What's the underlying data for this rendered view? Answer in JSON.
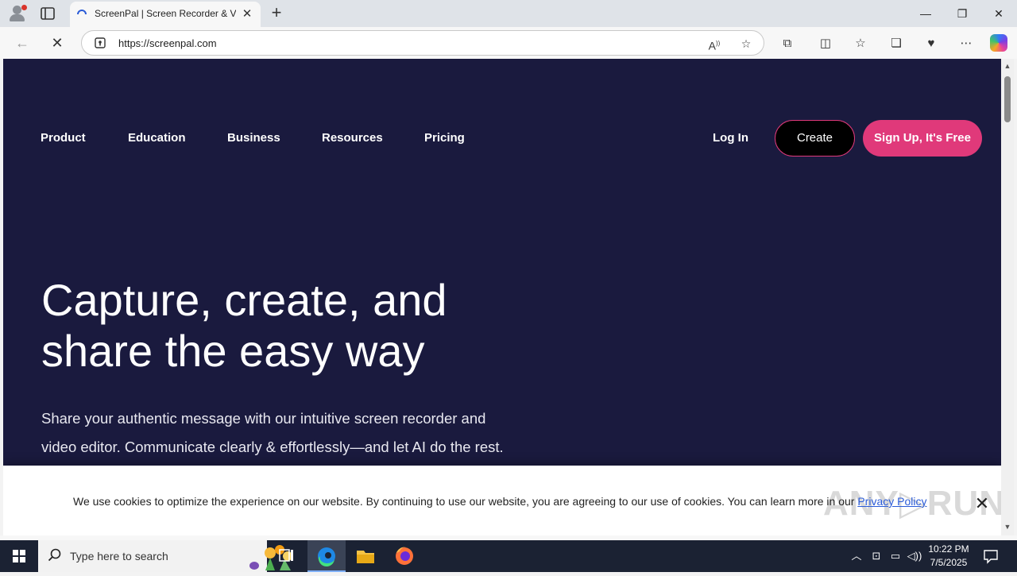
{
  "browser": {
    "tab": {
      "title": "ScreenPal | Screen Recorder & Video Editor",
      "close_glyph": "✕"
    },
    "new_tab_glyph": "+",
    "window_controls": {
      "minimize": "—",
      "restore": "❐",
      "close": "✕"
    },
    "nav": {
      "back": "←",
      "reload": "✕"
    },
    "address_bar": {
      "url": "https://screenpal.com"
    },
    "icons": [
      "read-aloud-icon",
      "favorite-star-icon",
      "extensions-icon",
      "split-screen-icon",
      "favorites-icon",
      "collections-icon",
      "browser-essentials-icon",
      "more-menu-icon",
      "copilot-icon"
    ]
  },
  "site": {
    "nav": {
      "items": [
        "Product",
        "Education",
        "Business",
        "Resources",
        "Pricing"
      ],
      "login": "Log In",
      "create": "Create",
      "signup": "Sign Up, It's Free"
    },
    "hero": {
      "title": "Capture, create, and share the easy way",
      "subtitle": "Share your authentic message with our intuitive screen recorder and video editor. Communicate clearly & effortlessly—and let AI do the rest."
    },
    "cookie": {
      "text": "We use cookies to optimize the experience on our website. By continuing to use our website, you are agreeing to our use of cookies. You can learn more in our ",
      "link": "Privacy Policy",
      "close": "✕"
    },
    "watermark": "ANY▷RUN"
  },
  "colors": {
    "page_background": "#1a1a3e",
    "accent_pink": "#e0397a",
    "taskbar": "#1b2233"
  },
  "taskbar": {
    "search_placeholder": "Type here to search",
    "apps": [
      "task-view-icon",
      "edge-icon",
      "file-explorer-icon",
      "firefox-icon"
    ],
    "tray": [
      "chevron-up-icon",
      "network-icon",
      "device-icon",
      "volume-icon"
    ],
    "clock": {
      "time": "10:22 PM",
      "date": "7/5/2025"
    }
  }
}
